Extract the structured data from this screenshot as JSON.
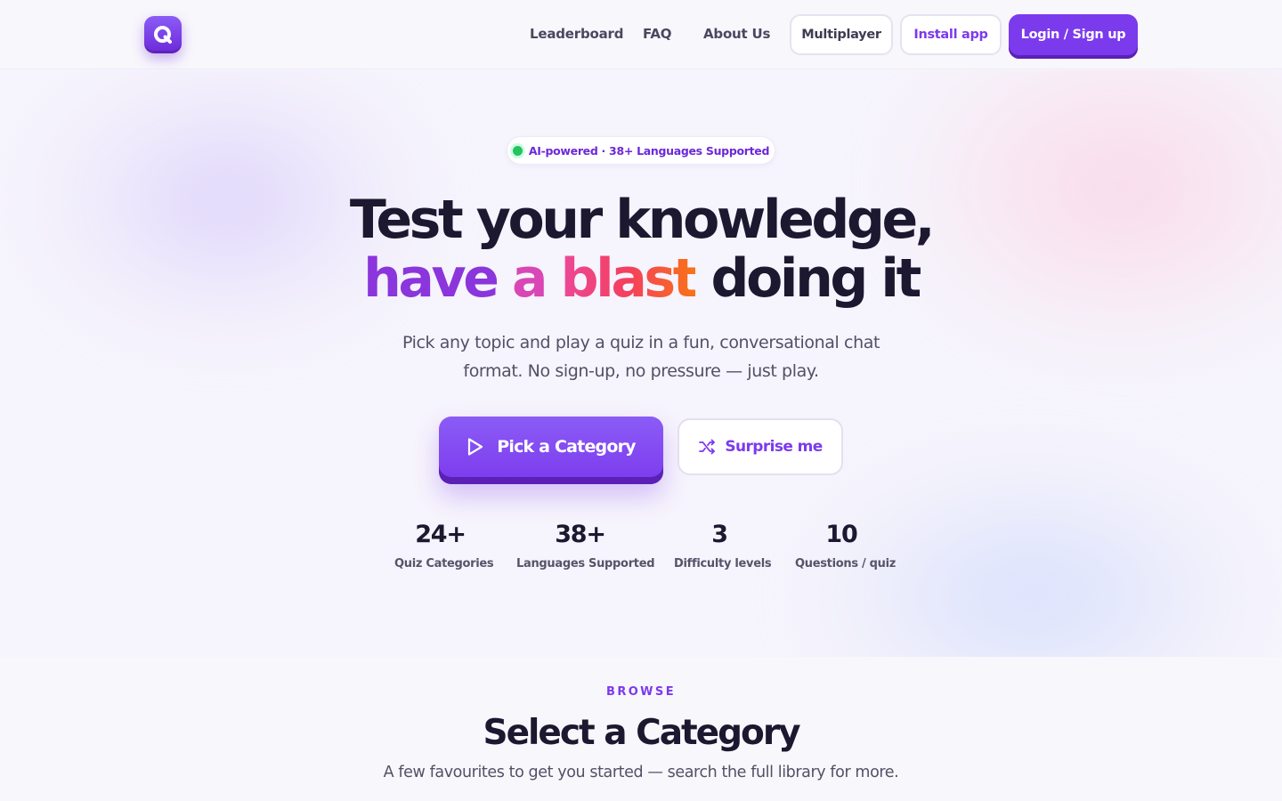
{
  "header": {
    "logo_letter": "Q",
    "nav": [
      {
        "label": "Leaderboard"
      },
      {
        "label": "FAQ"
      },
      {
        "label": "About Us"
      }
    ],
    "multiplayer_label": "Multiplayer",
    "install_label": "Install app",
    "login_label": "Login / Sign up"
  },
  "hero": {
    "badge": "AI-powered · 38+ Languages Supported",
    "title_line1": "Test your knowledge,",
    "title_word_have": "have",
    "title_word_a": "a",
    "title_word_blast": "blast",
    "title_rest": "doing it",
    "subtitle": "Pick any topic and play a quiz in a fun, conversational chat format. No sign-up, no pressure — just play.",
    "cta_primary": "Pick a Category",
    "cta_secondary": "Surprise me",
    "stats": [
      {
        "value": "24+",
        "label": "Quiz Categories"
      },
      {
        "value": "38+",
        "label": "Languages Supported"
      },
      {
        "value": "3",
        "label": "Difficulty levels"
      },
      {
        "value": "10",
        "label": "Questions / quiz"
      }
    ]
  },
  "browse": {
    "eyebrow": "BROWSE",
    "title": "Select a Category",
    "subtitle": "A few favourites to get you started — search the full library for more."
  },
  "colors": {
    "accent": "#7c3aed",
    "accent_dark": "#5b21b6",
    "status_dot": "#22c55e",
    "gradient_blast": [
      "#ec4899",
      "#f97316"
    ]
  },
  "icons": {
    "logo": "q-logo-icon",
    "badge_dot": "status-dot-icon",
    "cta_primary": "play-icon",
    "cta_secondary": "shuffle-icon"
  }
}
